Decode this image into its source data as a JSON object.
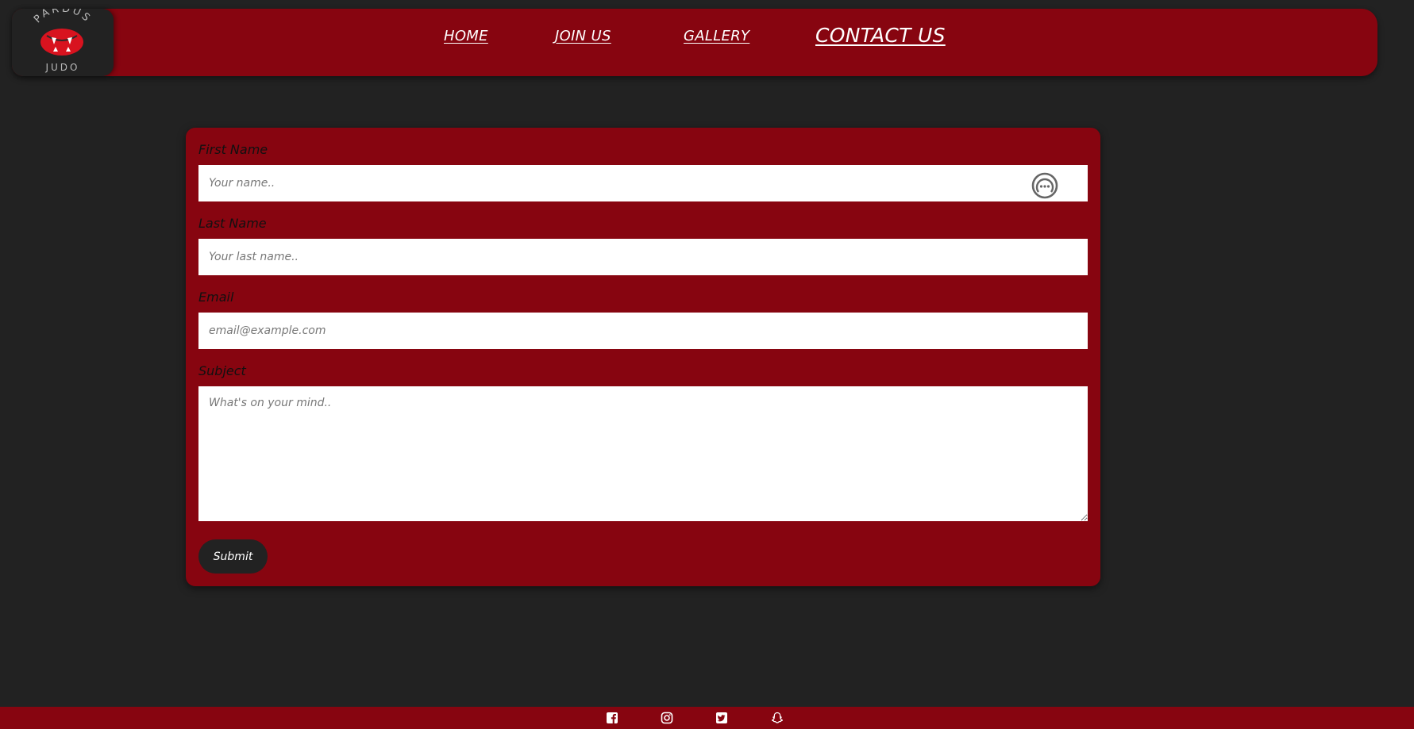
{
  "brand": {
    "logo_top_text": "PARDUS",
    "logo_bottom_text": "JUDO",
    "logo_icon": "leopard-mouth-icon"
  },
  "nav": {
    "items": [
      {
        "label": "HOME"
      },
      {
        "label": "JOIN US"
      },
      {
        "label": "GALLERY"
      },
      {
        "label": "CONTACT US"
      }
    ]
  },
  "form": {
    "first_name": {
      "label": "First Name",
      "placeholder": "Your name..",
      "value": ""
    },
    "last_name": {
      "label": "Last Name",
      "placeholder": "Your last name..",
      "value": ""
    },
    "email": {
      "label": "Email",
      "placeholder": "email@example.com",
      "value": ""
    },
    "subject": {
      "label": "Subject",
      "placeholder": "What's on your mind..",
      "value": ""
    },
    "submit_label": "Submit",
    "password_manager_icon": "password-manager-icon"
  },
  "footer": {
    "social_icons": [
      "facebook-icon",
      "instagram-icon",
      "twitter-icon",
      "snapchat-icon"
    ]
  },
  "colors": {
    "primary_red": "#870510",
    "background": "#222222",
    "text_white": "#ffffff",
    "label_dark": "#111111",
    "logo_accent": "#d8131f"
  }
}
